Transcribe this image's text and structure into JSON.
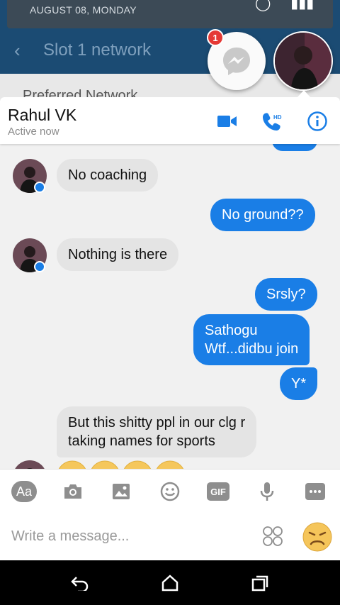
{
  "background": {
    "status_date": "AUGUST 08, MONDAY",
    "title": "Slot 1 network",
    "subtitle": "Preferred Network"
  },
  "chathead": {
    "badge_count": "1"
  },
  "header": {
    "name": "Rahul VK",
    "status": "Active now",
    "accent": "#1a7ee6"
  },
  "messages": [
    {
      "from": "them",
      "text": "No coaching"
    },
    {
      "from": "me",
      "text": "No ground??"
    },
    {
      "from": "them",
      "text": "Nothing is there"
    },
    {
      "from": "me",
      "text": "Srsly?"
    },
    {
      "from": "me",
      "text_lines": [
        "Sathogu",
        "Wtf...didbu join"
      ]
    },
    {
      "from": "me",
      "text": "Y*"
    },
    {
      "from": "them",
      "text_lines": [
        "But this shitty ppl in our clg r",
        "taking names for sports"
      ]
    }
  ],
  "toolbar": {
    "text_label": "Aa",
    "gif_label": "GIF"
  },
  "composer": {
    "placeholder": "Write a message..."
  }
}
